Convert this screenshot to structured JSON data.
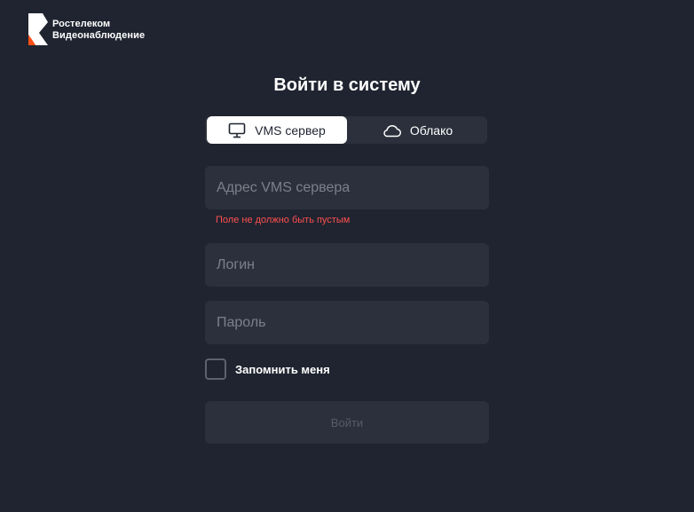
{
  "brand": {
    "line1": "Ростелеком",
    "line2": "Видеонаблюдение",
    "colors": {
      "accent": "#ff4f12",
      "background": "#1f2430",
      "surface": "#2b303c",
      "error": "#ff4f4f"
    }
  },
  "login": {
    "title": "Войти в систему",
    "tabs": [
      {
        "label": "VMS сервер",
        "icon": "monitor-icon",
        "active": true
      },
      {
        "label": "Облако",
        "icon": "cloud-icon",
        "active": false
      }
    ],
    "server_field": {
      "placeholder": "Адрес VMS сервера",
      "value": ""
    },
    "server_error": "Поле не должно быть пустым",
    "login_field": {
      "placeholder": "Логин",
      "value": ""
    },
    "password_field": {
      "placeholder": "Пароль",
      "value": ""
    },
    "remember_label": "Запомнить меня",
    "remember_checked": false,
    "submit_label": "Войти"
  }
}
